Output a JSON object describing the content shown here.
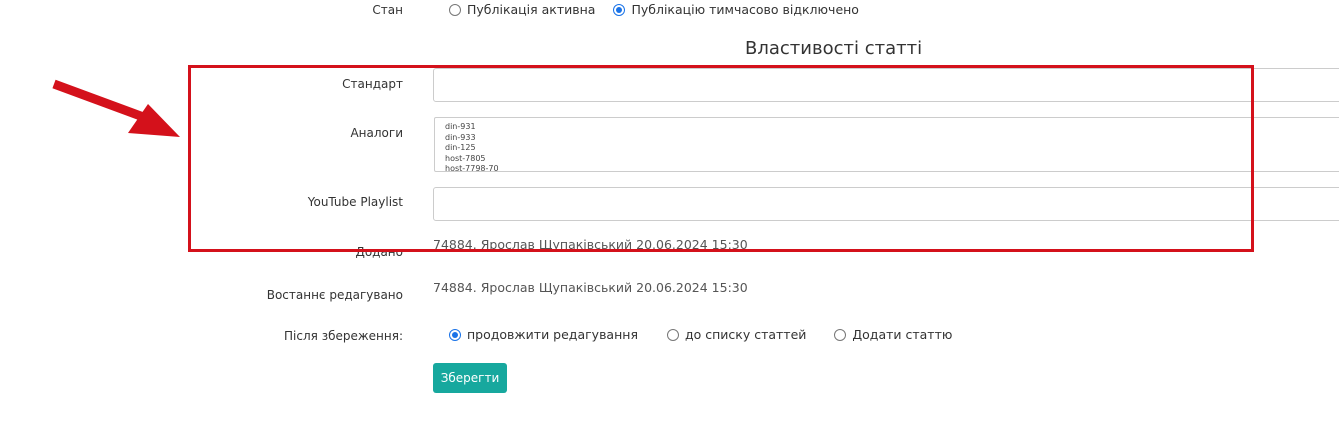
{
  "state": {
    "label": "Стан",
    "options": [
      {
        "label": "Публікація активна",
        "checked": false
      },
      {
        "label": "Публікацію тимчасово відключено",
        "checked": true
      }
    ]
  },
  "properties": {
    "title": "Властивості статті",
    "standard_label": "Стандарт",
    "standard_value": "",
    "analogs_label": "Аналоги",
    "analogs_lines": [
      "din-931",
      "din-933",
      "din-125",
      "host-7805",
      "host-7798-70"
    ],
    "youtube_label": "YouTube Playlist",
    "youtube_value": ""
  },
  "meta": {
    "added_label": "Додано",
    "added_value": "74884. Ярослав Щупаківський 20.06.2024 15:30",
    "edited_label": "Востаннє редагувано",
    "edited_value": "74884. Ярослав Щупаківський 20.06.2024 15:30"
  },
  "after_save": {
    "label": "Після збереження:",
    "options": [
      {
        "label": "продовжити редагування",
        "checked": true
      },
      {
        "label": "до списку статтей",
        "checked": false
      },
      {
        "label": "Додати статтю",
        "checked": false
      }
    ]
  },
  "save_button": "Зберегти",
  "colors": {
    "accent": "#17a89e",
    "highlight": "#d4111b",
    "radio": "#1a73e8"
  }
}
